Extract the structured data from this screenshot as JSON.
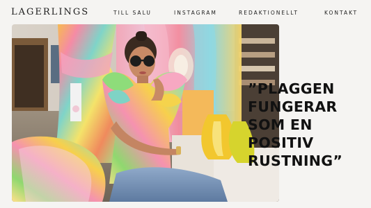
{
  "brand": {
    "name": "LAGERLINGS"
  },
  "nav": {
    "items": [
      {
        "label": "TILL SALU"
      },
      {
        "label": "INSTAGRAM"
      },
      {
        "label": "REDAKTIONELLT"
      },
      {
        "label": "KONTAKT"
      }
    ]
  },
  "hero": {
    "quote_lines": [
      "”PLAGGEN",
      "FUNGERAR",
      "SOM EN",
      "POSITIV",
      "RUSTNING”"
    ]
  }
}
